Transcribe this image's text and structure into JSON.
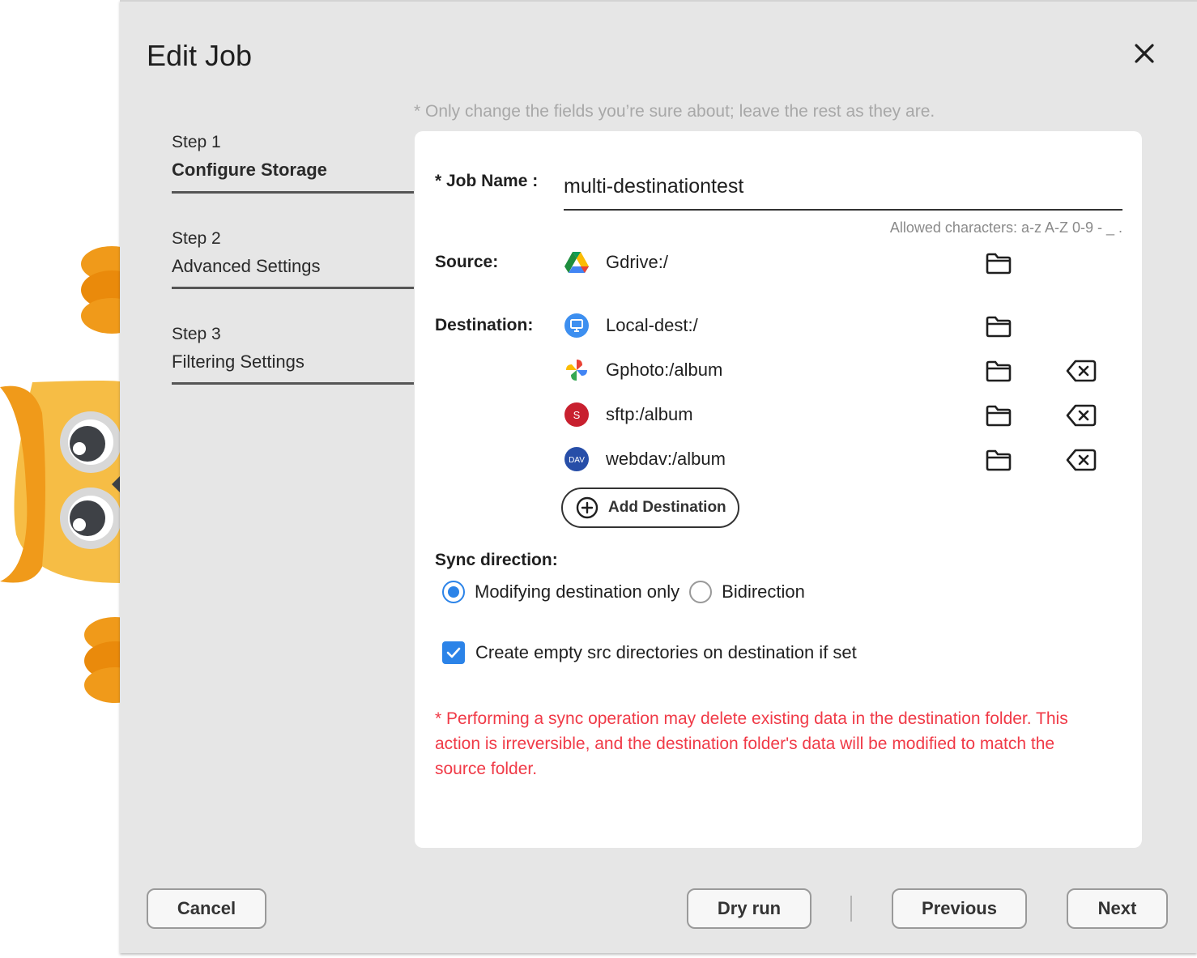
{
  "dialog": {
    "title": "Edit Job",
    "hint": "* Only change the fields you’re sure about; leave the rest as they are."
  },
  "steps": [
    {
      "num": "Step 1",
      "name": "Configure Storage",
      "active": true
    },
    {
      "num": "Step 2",
      "name": "Advanced Settings",
      "active": false
    },
    {
      "num": "Step 3",
      "name": "Filtering Settings",
      "active": false
    }
  ],
  "form": {
    "job_name_label": "* Job Name :",
    "job_name_value": "multi-destinationtest",
    "allowed_chars": "Allowed characters: a-z A-Z 0-9 - _ .",
    "source_label": "Source:",
    "source": {
      "service": "gdrive-icon",
      "path": "Gdrive:/"
    },
    "destination_label": "Destination:",
    "destinations": [
      {
        "service": "local-icon",
        "path": "Local-dest:/",
        "removable": false
      },
      {
        "service": "gphoto-icon",
        "path": "Gphoto:/album",
        "removable": true
      },
      {
        "service": "sftp-icon",
        "badge": "S",
        "path": "sftp:/album",
        "removable": true
      },
      {
        "service": "webdav-icon",
        "badge": "DAV",
        "path": "webdav:/album",
        "removable": true
      }
    ],
    "add_destination_label": "Add Destination",
    "sync_direction_label": "Sync direction:",
    "sync_options": [
      {
        "label": "Modifying destination only",
        "checked": true
      },
      {
        "label": "Bidirection",
        "checked": false
      }
    ],
    "create_empty_dirs_label": "Create empty src directories on destination if set",
    "create_empty_dirs_checked": true,
    "warning": "* Performing a sync operation may delete existing data in the destination folder. This action is irreversible, and the destination folder's data will be modified to match the source folder."
  },
  "footer": {
    "cancel_label": "Cancel",
    "dry_run_label": "Dry run",
    "previous_label": "Previous",
    "next_label": "Next"
  },
  "colors": {
    "accent": "#2b83e8",
    "warning": "#f03a47",
    "dialog_bg": "#e6e6e6",
    "owl_orange": "#f09a1a",
    "owl_yellow": "#f6bd45"
  }
}
